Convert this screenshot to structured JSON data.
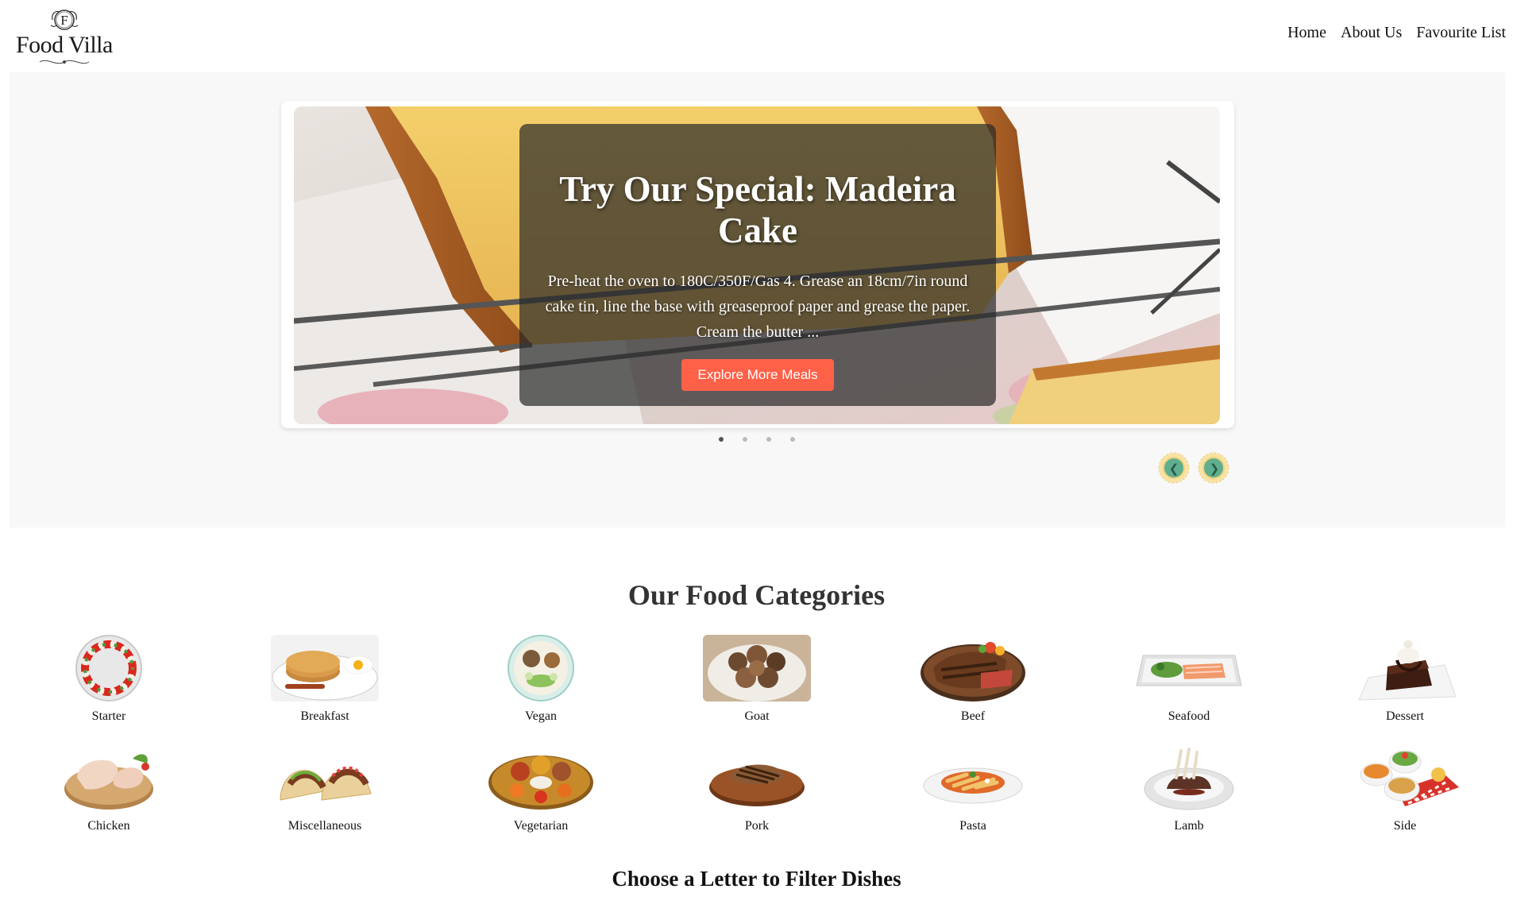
{
  "header": {
    "brand_initial": "F",
    "brand_name": "Food Villa",
    "nav": [
      "Home",
      "About Us",
      "Favourite List"
    ]
  },
  "hero": {
    "title": "Try Our Special: Madeira Cake",
    "description": "Pre-heat the oven to 180C/350F/Gas 4. Grease an 18cm/7in round cake tin, line the base with greaseproof paper and grease the paper. Cream the butter ...",
    "button_label": "Explore More Meals",
    "slide_count": 4,
    "active_slide": 1,
    "prev_arrow": "❮",
    "next_arrow": "❯"
  },
  "categories": {
    "title": "Our Food Categories",
    "items": [
      {
        "name": "Starter",
        "icon": "starter-plate-icon"
      },
      {
        "name": "Breakfast",
        "icon": "breakfast-plate-icon"
      },
      {
        "name": "Vegan",
        "icon": "vegan-bowl-icon"
      },
      {
        "name": "Goat",
        "icon": "goat-dish-icon"
      },
      {
        "name": "Beef",
        "icon": "steak-icon"
      },
      {
        "name": "Seafood",
        "icon": "seafood-plate-icon"
      },
      {
        "name": "Dessert",
        "icon": "cake-icon"
      },
      {
        "name": "Chicken",
        "icon": "chicken-icon"
      },
      {
        "name": "Miscellaneous",
        "icon": "taco-icon"
      },
      {
        "name": "Vegetarian",
        "icon": "thali-icon"
      },
      {
        "name": "Pork",
        "icon": "pork-chop-icon"
      },
      {
        "name": "Pasta",
        "icon": "pasta-icon"
      },
      {
        "name": "Lamb",
        "icon": "lamb-rack-icon"
      },
      {
        "name": "Side",
        "icon": "side-dishes-icon"
      }
    ]
  },
  "filter": {
    "title": "Choose a Letter to Filter Dishes"
  },
  "colors": {
    "accent": "#ff6148",
    "hero_bg": "#f8f8f8",
    "arrow_fill": "#5fae8f",
    "arrow_ring": "#f5d98a"
  }
}
